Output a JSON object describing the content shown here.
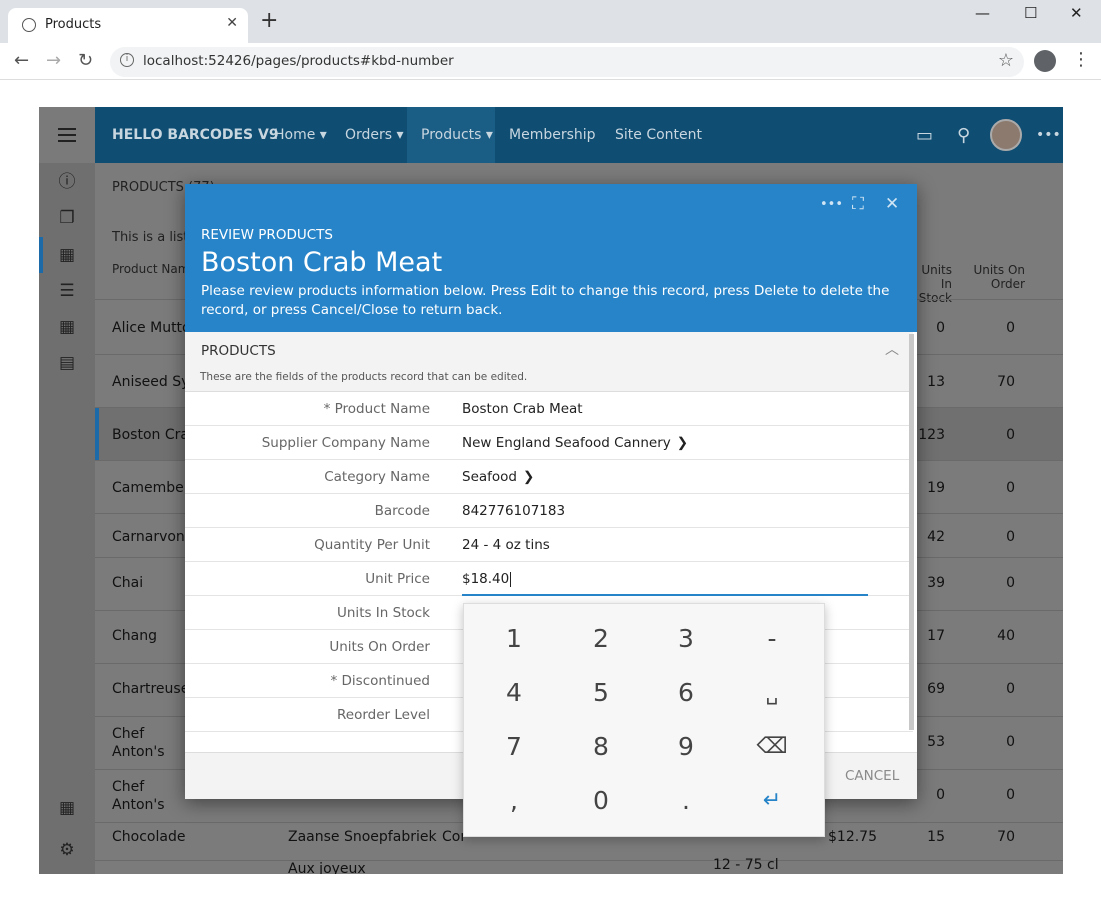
{
  "browser": {
    "tab_title": "Products",
    "tab_close": "✕",
    "new_tab": "+",
    "url": "localhost:52426/pages/products#kbd-number",
    "win_min": "—",
    "win_max": "☐",
    "win_close": "✕",
    "back": "←",
    "forward": "→",
    "reload": "↻",
    "star": "☆",
    "kebab": "⋮"
  },
  "topnav": {
    "brand": "HELLO BARCODES V9",
    "items": [
      "Home ▾",
      "Orders ▾",
      "Products ▾",
      "Membership",
      "Site Content"
    ],
    "active": "Products"
  },
  "page": {
    "heading": "PRODUCTS (77)",
    "description": "This is a list",
    "columns": {
      "product_name": "Product Name",
      "units_in_stock": "Units In Stock",
      "units_on_order": "Units On Order"
    },
    "rows": [
      {
        "name": "Alice Mutto",
        "stock": "0",
        "order": "0"
      },
      {
        "name": "Aniseed Syr",
        "stock": "13",
        "order": "70"
      },
      {
        "name": "Boston Crab",
        "stock": "123",
        "order": "0"
      },
      {
        "name": "Camembert",
        "stock": "19",
        "order": "0"
      },
      {
        "name": "Carnarvon T",
        "stock": "42",
        "order": "0"
      },
      {
        "name": "Chai",
        "stock": "39",
        "order": "0"
      },
      {
        "name": "Chang",
        "stock": "17",
        "order": "40"
      },
      {
        "name": "Chartreuse v",
        "stock": "69",
        "order": "0"
      },
      {
        "name": "Chef Anton's Seasoning",
        "stock": "53",
        "order": "0"
      },
      {
        "name": "Chef Anton's Mix",
        "stock": "0",
        "order": "0"
      },
      {
        "name": "Chocolade",
        "supplier": "Zaanse Snoepfabriek",
        "category": "Cor",
        "price": "$12.75",
        "stock": "15",
        "order": "70"
      },
      {
        "name": "",
        "supplier": "Aux joyeux",
        "qty": "12 - 75 cl"
      }
    ]
  },
  "modal": {
    "kicker": "REVIEW PRODUCTS",
    "title": "Boston Crab Meat",
    "description": "Please review products information below. Press Edit to change this record, press Delete to delete the record, or press Cancel/Close to return back.",
    "tools": {
      "more": "•••",
      "fullscreen": "⛶",
      "close": "✕"
    },
    "section_title": "PRODUCTS",
    "section_desc": "These are the fields of the products record that can be edited.",
    "fields": [
      {
        "label": "* Product Name",
        "value": "Boston Crab Meat"
      },
      {
        "label": "Supplier Company Name",
        "value": "New England Seafood Cannery",
        "arrow": "❯"
      },
      {
        "label": "Category Name",
        "value": "Seafood",
        "arrow": "❯"
      },
      {
        "label": "Barcode",
        "value": "842776107183"
      },
      {
        "label": "Quantity Per Unit",
        "value": "24 - 4 oz tins"
      },
      {
        "label": "Unit Price",
        "value": "$18.40"
      },
      {
        "label": "Units In Stock",
        "value": ""
      },
      {
        "label": "Units On Order",
        "value": ""
      },
      {
        "label": "* Discontinued",
        "value": ""
      },
      {
        "label": "Reorder Level",
        "value": ""
      }
    ],
    "cancel_label": "CANCEL"
  },
  "keypad": {
    "keys": [
      [
        "1",
        "2",
        "3",
        "-"
      ],
      [
        "4",
        "5",
        "6",
        "␣"
      ],
      [
        "7",
        "8",
        "9",
        "⌫"
      ],
      [
        ",",
        "0",
        ".",
        "↵"
      ]
    ]
  },
  "colors": {
    "accent": "#2784c8",
    "navbar": "#0f4d72",
    "overlay": "#7b7b7b"
  }
}
